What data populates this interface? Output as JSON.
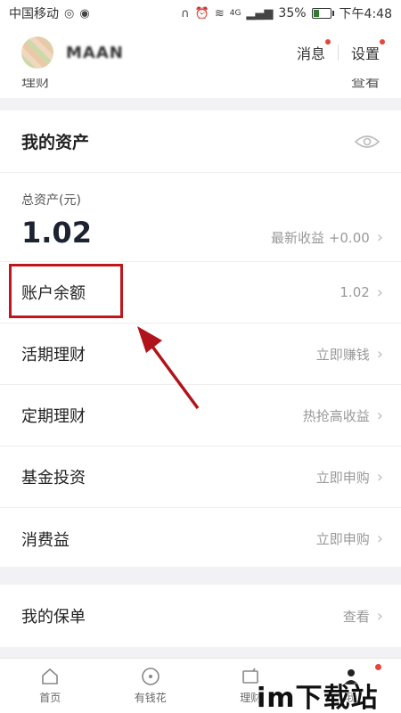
{
  "status_bar": {
    "carrier": "中国移动",
    "network": "4G",
    "battery": "35%",
    "battery_level": 0.35,
    "time": "下午4:48"
  },
  "header": {
    "username": "MAAN",
    "messages_label": "消息",
    "settings_label": "设置"
  },
  "peek_row": {
    "left": "理财",
    "right": "查看"
  },
  "assets": {
    "title": "我的资产",
    "total_label": "总资产(元)",
    "total_value": "1.02",
    "latest_income": "最新收益 +0.00",
    "rows": [
      {
        "label": "账户余额",
        "value": "1.02"
      },
      {
        "label": "活期理财",
        "value": "立即赚钱"
      },
      {
        "label": "定期理财",
        "value": "热抢高收益"
      },
      {
        "label": "基金投资",
        "value": "立即申购"
      },
      {
        "label": "消费益",
        "value": "立即申购"
      }
    ]
  },
  "policy": {
    "label": "我的保单",
    "value": "查看"
  },
  "bottom_nav": [
    {
      "label": "首页",
      "icon": "home-icon"
    },
    {
      "label": "有钱花",
      "icon": "coin-icon"
    },
    {
      "label": "理财",
      "icon": "wallet-icon"
    },
    {
      "label": "我",
      "icon": "profile-icon"
    }
  ],
  "watermark": "im下载站",
  "colors": {
    "highlight": "#c0161c",
    "badge": "#e6453b"
  }
}
